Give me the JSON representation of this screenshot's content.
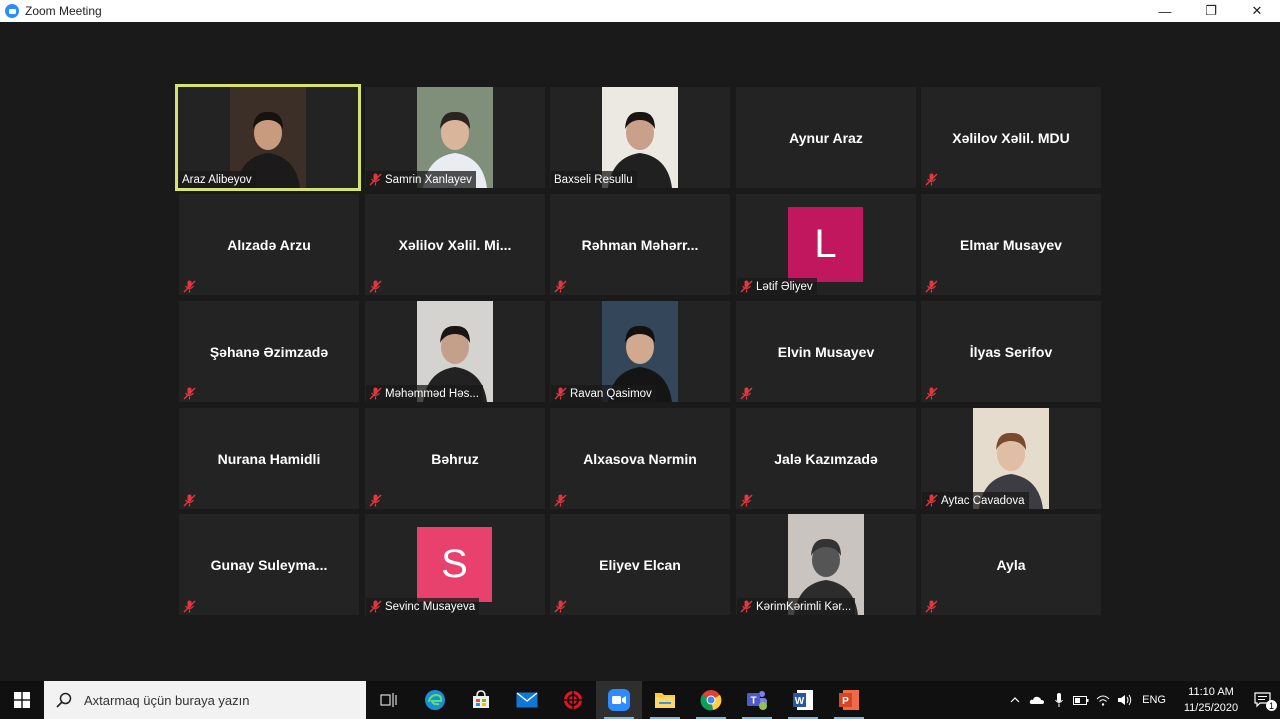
{
  "window": {
    "title": "Zoom Meeting",
    "minimize": "—",
    "maximize": "❐",
    "close": "✕"
  },
  "colors": {
    "active_speaker": "#d6e46d",
    "tile_bg": "#232323",
    "mute_red": "#e0383e",
    "avatar_l": "#c0175f",
    "avatar_s": "#e9416e"
  },
  "participants": [
    {
      "name": "Araz Alibeyov",
      "kind": "video",
      "active": true,
      "muted": false
    },
    {
      "name": "Samrin Xanlayev",
      "kind": "video",
      "muted": true
    },
    {
      "name": "Baxseli Resullu",
      "kind": "video",
      "muted": false
    },
    {
      "name": "Aynur Araz",
      "kind": "name",
      "muted": false
    },
    {
      "name": "Xəlilov Xəlil. MDU",
      "kind": "name",
      "muted": true
    },
    {
      "name": "Alızadə Arzu",
      "kind": "name",
      "muted": true
    },
    {
      "name": "Xəlilov  Xəlil.  Mi...",
      "kind": "name",
      "muted": true
    },
    {
      "name": "Rəhman  Məhərr...",
      "kind": "name",
      "muted": true
    },
    {
      "name": "Lətif Əliyev",
      "kind": "avatar",
      "initial": "L",
      "muted": true
    },
    {
      "name": "Elmar Musayev",
      "kind": "name",
      "muted": true
    },
    {
      "name": "Şəhanə Əzimzadə",
      "kind": "name",
      "muted": true
    },
    {
      "name": "Məhəmməd Həs...",
      "kind": "video",
      "muted": true
    },
    {
      "name": "Ravan Qasimov",
      "kind": "video",
      "muted": true
    },
    {
      "name": "Elvin Musayev",
      "kind": "name",
      "muted": true
    },
    {
      "name": "İlyas Serifov",
      "kind": "name",
      "muted": true
    },
    {
      "name": "Nurana Hamidli",
      "kind": "name",
      "muted": true
    },
    {
      "name": "Bəhruz",
      "kind": "name",
      "muted": true
    },
    {
      "name": "Alxasova Nərmin",
      "kind": "name",
      "muted": true
    },
    {
      "name": "Jalə Kazımzadə",
      "kind": "name",
      "muted": true
    },
    {
      "name": "Aytac Cavadova",
      "kind": "video",
      "muted": true
    },
    {
      "name": "Gunay  Suleyma...",
      "kind": "name",
      "muted": true
    },
    {
      "name": "Sevinc Musayeva",
      "kind": "avatar",
      "initial": "S",
      "muted": true
    },
    {
      "name": "Eliyev Elcan",
      "kind": "name",
      "muted": true
    },
    {
      "name": "KərimKərimli Kər...",
      "kind": "video",
      "muted": true
    },
    {
      "name": "Ayla",
      "kind": "name",
      "muted": true
    }
  ],
  "taskbar": {
    "search_placeholder": "Axtarmaq üçün buraya yazın",
    "apps": [
      "task-view-icon",
      "edge-icon",
      "store-icon",
      "mail-icon",
      "red-app-icon",
      "zoom-icon",
      "file-explorer-icon",
      "chrome-icon",
      "teams-icon",
      "word-icon",
      "powerpoint-icon"
    ],
    "language": "ENG",
    "time": "11:10 AM",
    "date": "11/25/2020",
    "notifications": "1"
  }
}
